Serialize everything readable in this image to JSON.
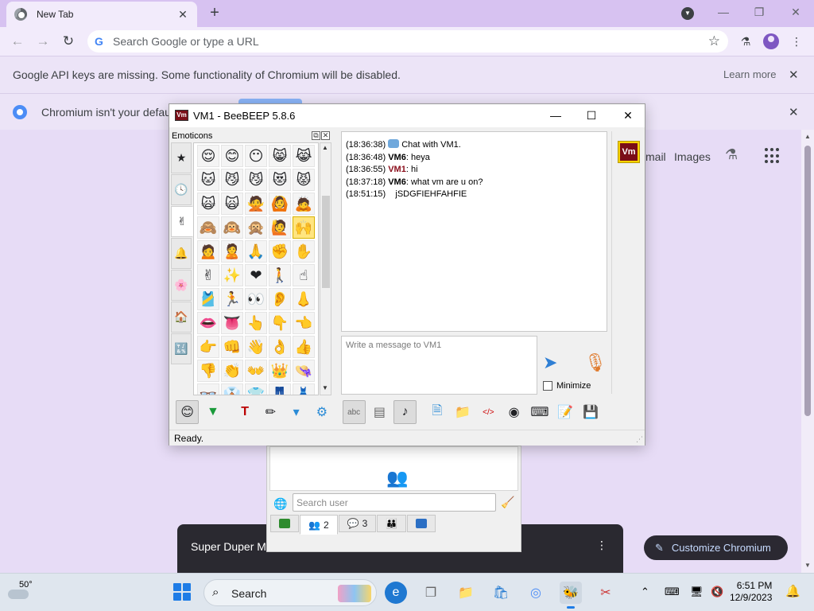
{
  "browser": {
    "tab_title": "New Tab",
    "tab_close": "✕",
    "new_tab": "+",
    "omnibox_placeholder": "Search Google or type a URL",
    "info_api_message": "Google API keys are missing. Some functionality of Chromium will be disabled.",
    "info_learn_more": "Learn more",
    "info_default_message": "Chromium isn't your default",
    "ntp_links": [
      "mail",
      "Images"
    ],
    "shortcut_card_title": "Super Duper M",
    "customize_label": "Customize Chromium"
  },
  "chat_window": {
    "title": "VM1 - BeeBEEP 5.8.6",
    "app_icon_text": "Vm",
    "emoticons_label": "Emoticons",
    "emoticon_categories": [
      "★",
      "🕓",
      "✌",
      "🔔",
      "🌸",
      "🏠",
      "🔣"
    ],
    "emoticons": [
      "😌",
      "😊",
      "😶",
      "😸",
      "😹",
      "🐱",
      "😼",
      "😼",
      "😻",
      "😾",
      "🙀",
      "🙀",
      "🙅",
      "🙆",
      "🙇",
      "🙈",
      "🙉",
      "🙊",
      "🙋",
      "🙌",
      "🙍",
      "🙎",
      "🙏",
      "✊",
      "✋",
      "✌",
      "✨",
      "❤",
      "🚶",
      "☝",
      "🎽",
      "🏃",
      "👀",
      "👂",
      "👃",
      "👄",
      "👅",
      "👆",
      "👇",
      "👈",
      "👉",
      "👊",
      "👋",
      "👌",
      "👍",
      "👎",
      "👏",
      "👐",
      "👑",
      "👒",
      "👓",
      "👔",
      "👕",
      "👖",
      "👗",
      "👘",
      "👙",
      "👚",
      "👛",
      "👜"
    ],
    "selected_emoticon_index": 19,
    "messages": [
      {
        "time": "(18:36:38)",
        "who": "",
        "text": "Chat with VM1.",
        "system": true
      },
      {
        "time": "(18:36:48)",
        "who": "VM6",
        "text": ": heya",
        "system": false
      },
      {
        "time": "(18:36:55)",
        "who": "VM1",
        "text": ": hi",
        "system": false
      },
      {
        "time": "(18:37:18)",
        "who": "VM6",
        "text": ": what vm are u on?",
        "system": false
      },
      {
        "time": "(18:51:15)",
        "who": "",
        "text": "   jSDGFIEHFAHFIE",
        "system": false
      }
    ],
    "composer_placeholder": "Write a message to VM1",
    "minimize_label": "Minimize",
    "status": "Ready.",
    "contact_badge": "Vm"
  },
  "user_window": {
    "search_placeholder": "Search user",
    "tabs": [
      {
        "icon": "network-icon",
        "label": ""
      },
      {
        "icon": "users-icon",
        "label": "2"
      },
      {
        "icon": "chats-icon",
        "label": "3"
      },
      {
        "icon": "groups-icon",
        "label": ""
      },
      {
        "icon": "share-icon",
        "label": ""
      }
    ]
  },
  "taskbar": {
    "temperature": "50°",
    "search_label": "Search",
    "time": "6:51 PM",
    "date": "12/9/2023"
  },
  "colors": {
    "chrome_tabstrip": "#d7c2f1",
    "chrome_toolbar": "#f2ebfb",
    "vm1_name": "#8b0f1c",
    "badge_yellow": "#f7d300"
  }
}
